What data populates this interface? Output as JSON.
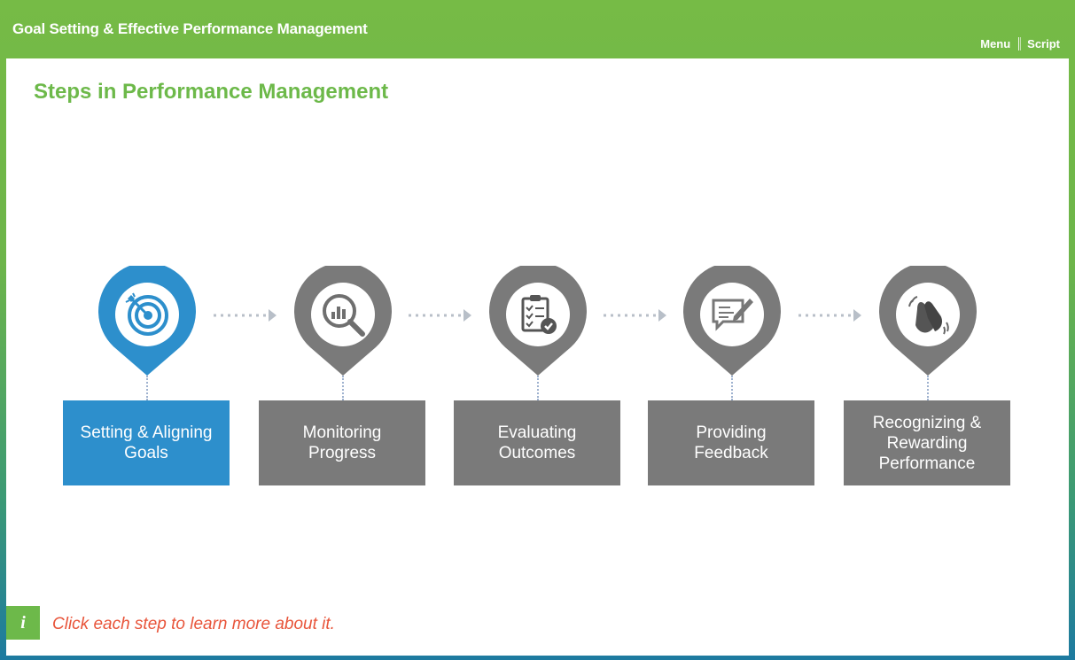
{
  "header": {
    "course_title": "Goal Setting & Effective Performance Management",
    "menu_label": "Menu",
    "script_label": "Script"
  },
  "page": {
    "title": "Steps in Performance Management"
  },
  "steps": [
    {
      "label": "Setting & Aligning\nGoals",
      "icon": "target-icon",
      "active": true
    },
    {
      "label": "Monitoring\nProgress",
      "icon": "magnifier-chart-icon",
      "active": false
    },
    {
      "label": "Evaluating\nOutcomes",
      "icon": "clipboard-check-icon",
      "active": false
    },
    {
      "label": "Providing\nFeedback",
      "icon": "feedback-icon",
      "active": false
    },
    {
      "label": "Recognizing &\nRewarding\nPerformance",
      "icon": "clapping-hands-icon",
      "active": false
    }
  ],
  "instruction": {
    "icon_glyph": "i",
    "text": "Click each step to learn more about it."
  },
  "colors": {
    "header_green": "#76bb46",
    "title_green": "#6db94a",
    "active_blue": "#2d8fcc",
    "inactive_gray": "#7a7a7a",
    "instruction_red": "#e8553b"
  }
}
